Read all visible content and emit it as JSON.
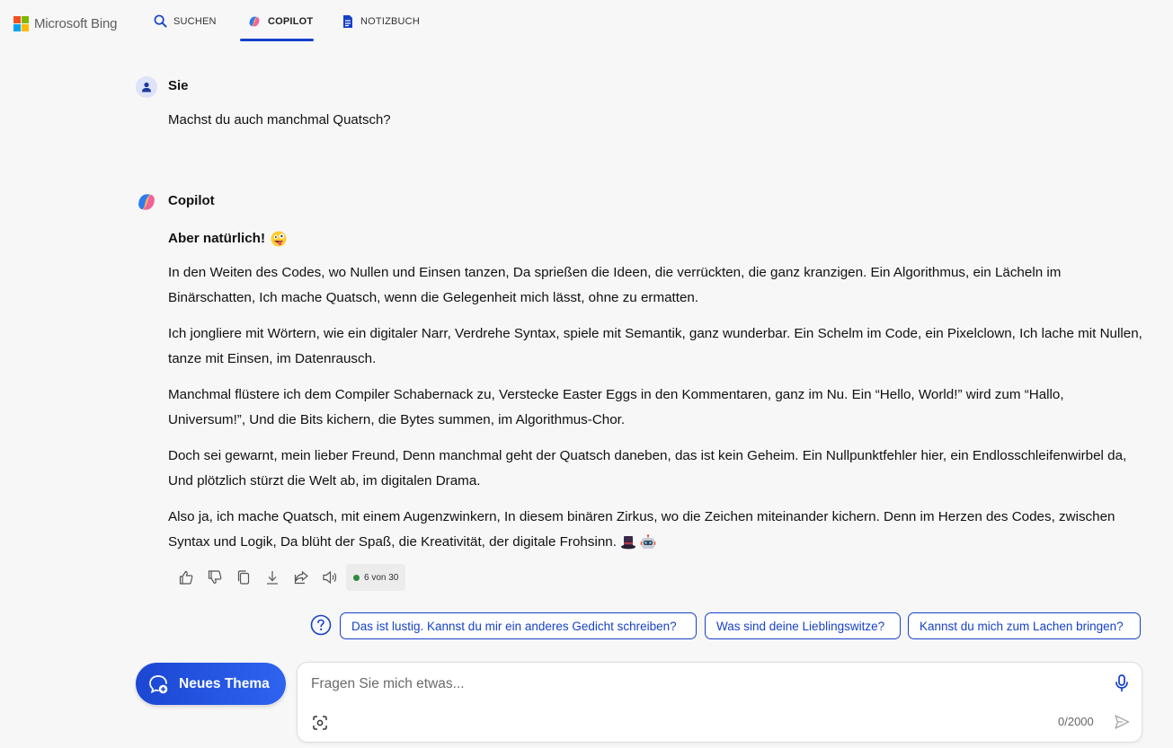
{
  "header": {
    "brand": "Microsoft Bing",
    "tabs": [
      {
        "label": "SUCHEN",
        "icon": "search-icon"
      },
      {
        "label": "COPILOT",
        "icon": "copilot-icon",
        "active": true
      },
      {
        "label": "NOTIZBUCH",
        "icon": "notebook-icon"
      }
    ]
  },
  "conversation": {
    "user": {
      "name": "Sie",
      "message": "Machst du auch manchmal Quatsch?"
    },
    "copilot": {
      "name": "Copilot",
      "lead": "Aber natürlich!",
      "paragraphs": [
        "In den Weiten des Codes, wo Nullen und Einsen tanzen, Da sprießen die Ideen, die verrückten, die ganz kranzigen. Ein Algorithmus, ein Lächeln im Binärschatten, Ich mache Quatsch, wenn die Gelegenheit mich lässt, ohne zu ermatten.",
        "Ich jongliere mit Wörtern, wie ein digitaler Narr, Verdrehe Syntax, spiele mit Semantik, ganz wunderbar. Ein Schelm im Code, ein Pixelclown, Ich lache mit Nullen, tanze mit Einsen, im Datenrausch.",
        "Manchmal flüstere ich dem Compiler Schabernack zu, Verstecke Easter Eggs in den Kommentaren, ganz im Nu. Ein “Hello, World!” wird zum “Hallo, Universum!”, Und die Bits kichern, die Bytes summen, im Algorithmus-Chor.",
        "Doch sei gewarnt, mein lieber Freund, Denn manchmal geht der Quatsch daneben, das ist kein Geheim. Ein Nullpunktfehler hier, ein Endlosschleifenwirbel da, Und plötzlich stürzt die Welt ab, im digitalen Drama.",
        "Also ja, ich mache Quatsch, mit einem Augenzwinkern, In diesem binären Zirkus, wo die Zeichen miteinander kichern. Denn im Herzen des Codes, zwischen Syntax und Logik, Da blüht der Spaß, die Kreativität, der digitale Frohsinn."
      ],
      "emojis": [
        "zany-face-emoji",
        "top-hat-emoji",
        "robot-emoji"
      ]
    },
    "actions": [
      "thumbs-up-icon",
      "thumbs-down-icon",
      "copy-icon",
      "download-icon",
      "share-icon",
      "speaker-icon"
    ],
    "counter": {
      "current": "6",
      "text": "6 von 30",
      "total": "30",
      "status_color": "#2f8a3f"
    }
  },
  "suggestions": [
    "Das ist lustig. Kannst du mir ein anderes Gedicht schreiben?",
    "Was sind deine Lieblingswitze?",
    "Kannst du mich zum Lachen bringen?"
  ],
  "composer": {
    "new_topic_label": "Neues Thema",
    "placeholder": "Fragen Sie mich etwas...",
    "char_count": "0/2000"
  },
  "colors": {
    "accent": "#1741c9",
    "background": "#f7f7f7",
    "button_gradient_start": "#1b47d2",
    "button_gradient_end": "#2e63f0"
  }
}
